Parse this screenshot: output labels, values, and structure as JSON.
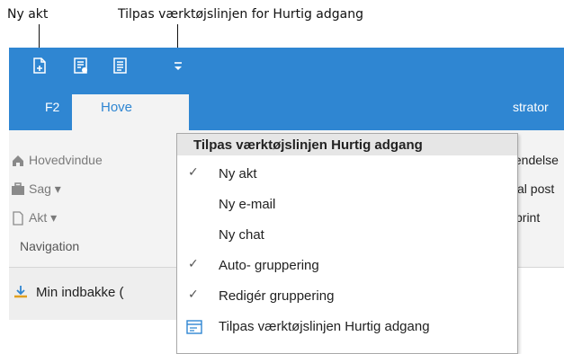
{
  "annotations": {
    "new_doc": "Ny akt",
    "customize_toolbar": "Tilpas værktøjslinjen for Hurtig adgang"
  },
  "quick_access": {
    "icons": [
      "new-document-icon",
      "form-icon",
      "list-icon",
      "customize-dropdown-icon"
    ]
  },
  "ribbon": {
    "tabs": [
      {
        "label": "F2"
      },
      {
        "label": "Hove"
      },
      {
        "label": "strator"
      }
    ],
    "left_items": [
      {
        "label": "Hovedvindue",
        "icon": "home-icon"
      },
      {
        "label": "Sag ▾",
        "icon": "case-icon"
      },
      {
        "label": "Akt ▾",
        "icon": "document-icon"
      }
    ],
    "group_label": "Navigation",
    "right_items": [
      {
        "label": "tendelse"
      },
      {
        "label": "al post"
      },
      {
        "label": "print"
      }
    ]
  },
  "inbox": {
    "label": "Min indbakke (",
    "icon": "download-icon"
  },
  "menu": {
    "title": "Tilpas værktøjslinjen Hurtig adgang",
    "items": [
      {
        "label": "Ny akt",
        "checked": "✓"
      },
      {
        "label": "Ny e-mail",
        "checked": ""
      },
      {
        "label": "Ny chat",
        "checked": ""
      },
      {
        "label": "Auto- gruppering",
        "checked": "✓"
      },
      {
        "label": "Redigér gruppering",
        "checked": "✓"
      },
      {
        "label": "Tilpas værktøjslinjen Hurtig adgang",
        "checked": "",
        "icon": "customize-toolbar-icon"
      }
    ]
  },
  "colors": {
    "accent": "#2f86d2",
    "ribbon_bg": "#f3f3f3"
  }
}
